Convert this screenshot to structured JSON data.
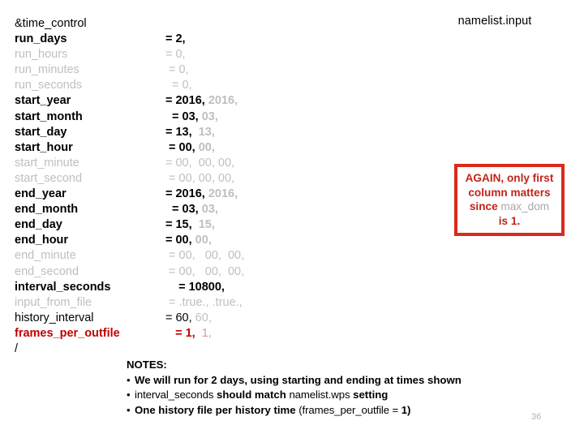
{
  "slide": {
    "title": "namelist.input",
    "page_number": "36"
  },
  "namelist": {
    "open_tag": "&time_control",
    "close_tag": "/",
    "rows": [
      {
        "key": "run_days",
        "style": "bold",
        "pad": "",
        "v1": "= 2,",
        "v2": "",
        "v3": ""
      },
      {
        "key": "run_hours",
        "style": "dim",
        "pad": "",
        "v1": "= 0,",
        "v2": "",
        "v3": ""
      },
      {
        "key": "run_minutes",
        "style": "dim",
        "pad": " ",
        "v1": "= 0,",
        "v2": "",
        "v3": ""
      },
      {
        "key": "run_seconds",
        "style": "dim",
        "pad": "  ",
        "v1": "= 0,",
        "v2": "",
        "v3": ""
      },
      {
        "key": "start_year",
        "style": "bold",
        "pad": "",
        "v1": "= 2016,",
        "v2": " 2016,",
        "v3": ""
      },
      {
        "key": "start_month",
        "style": "bold",
        "pad": "  ",
        "v1": "= 03,",
        "v2": " 03,",
        "v3": ""
      },
      {
        "key": "start_day",
        "style": "bold",
        "pad": "",
        "v1": "= 13,",
        "v2": "  13,",
        "v3": ""
      },
      {
        "key": "start_hour",
        "style": "bold",
        "pad": " ",
        "v1": "= 00,",
        "v2": " 00,",
        "v3": ""
      },
      {
        "key": "start_minute",
        "style": "dim",
        "pad": "",
        "v1": "= 00,",
        "v2": "  00,",
        "v3": " 00,"
      },
      {
        "key": "start_second",
        "style": "dim",
        "pad": " ",
        "v1": "= 00,",
        "v2": " 00,",
        "v3": " 00,"
      },
      {
        "key": "end_year",
        "style": "bold",
        "pad": "",
        "v1": "= 2016,",
        "v2": " 2016,",
        "v3": ""
      },
      {
        "key": "end_month",
        "style": "bold",
        "pad": "  ",
        "v1": "= 03,",
        "v2": " 03,",
        "v3": ""
      },
      {
        "key": "end_day",
        "style": "bold",
        "pad": "",
        "v1": "= 15,",
        "v2": "  15,",
        "v3": ""
      },
      {
        "key": "end_hour",
        "style": "bold",
        "pad": "",
        "v1": "= 00,",
        "v2": " 00,",
        "v3": ""
      },
      {
        "key": "end_minute",
        "style": "dim",
        "pad": " ",
        "v1": "= 00,",
        "v2": "   00,",
        "v3": "  00,"
      },
      {
        "key": "end_second",
        "style": "dim",
        "pad": " ",
        "v1": "= 00,",
        "v2": "   00,",
        "v3": "  00,"
      },
      {
        "key": "interval_seconds",
        "style": "bold",
        "pad": "    ",
        "v1": "= 10800,",
        "v2": "",
        "v3": ""
      },
      {
        "key": "input_from_file",
        "style": "dim",
        "pad": " ",
        "v1": "= .true.,",
        "v2": " .true.,",
        "v3": ""
      },
      {
        "key": "history_interval",
        "style": "normal",
        "pad": "",
        "v1": "= 60,",
        "v2": " 60,",
        "v3": ""
      },
      {
        "key": "frames_per_outfile",
        "style": "red",
        "pad": "   ",
        "v1": "= 1,",
        "v2": "  1,",
        "v3": ""
      }
    ]
  },
  "callout": {
    "line1": "AGAIN, only first",
    "line2": "column matters",
    "line3_pre": "since ",
    "line3_code": "max_dom",
    "line4": "is 1."
  },
  "notes": {
    "heading": "NOTES:",
    "bullet_glyph": "•",
    "items": [
      [
        {
          "t": "We will run for ",
          "s": "b"
        },
        {
          "t": "2 days",
          "s": "b"
        },
        {
          "t": ", using starting and ending at times shown",
          "s": "b"
        }
      ],
      [
        {
          "t": "interval_seconds",
          "s": "code"
        },
        {
          "t": " should match ",
          "s": "b"
        },
        {
          "t": "namelist.wps",
          "s": "code"
        },
        {
          "t": " setting",
          "s": "b"
        }
      ],
      [
        {
          "t": "One history file per history time ",
          "s": "b"
        },
        {
          "t": "(frames_per_outfile = ",
          "s": "code"
        },
        {
          "t": "1)",
          "s": "b"
        }
      ]
    ]
  }
}
